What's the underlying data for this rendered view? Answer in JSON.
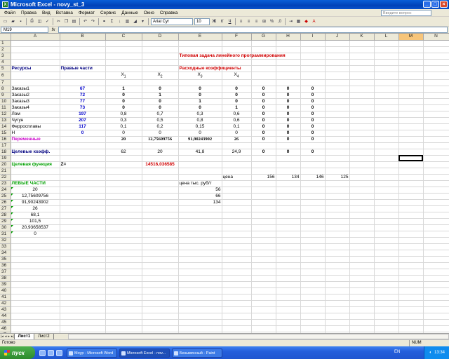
{
  "app": {
    "title": "Microsoft Excel - novy_st_3",
    "icon": "excel-app-icon"
  },
  "menu": [
    "Файл",
    "Правка",
    "Вид",
    "Вставка",
    "Формат",
    "Сервис",
    "Данные",
    "Окно",
    "Справка"
  ],
  "help_placeholder": "Введите вопрос",
  "toolbar": {
    "font": "Arial Cyr",
    "size": "10"
  },
  "namebox": "M19",
  "fx_label": "fx",
  "columns": [
    "",
    "A",
    "B",
    "C",
    "D",
    "E",
    "F",
    "G",
    "H",
    "I",
    "J",
    "K",
    "L",
    "M",
    "N"
  ],
  "rows": [
    "1",
    "2",
    "3",
    "4",
    "5",
    "6",
    "7",
    "8",
    "9",
    "10",
    "11",
    "12",
    "13",
    "14",
    "15",
    "16",
    "17",
    "18",
    "19",
    "20",
    "21",
    "22",
    "23",
    "24",
    "25",
    "26",
    "27",
    "28",
    "29",
    "30",
    "31",
    "32",
    "33",
    "34",
    "35",
    "36",
    "37",
    "38",
    "39",
    "40",
    "41",
    "42",
    "43",
    "44",
    "45",
    "46",
    "47"
  ],
  "cells": {
    "title": "Типовая задача линейного программирования",
    "resources": "Ресурсы",
    "rhs": "Правые  части",
    "rate_coef": "Расходные коэффициенты",
    "x1": "X",
    "x2": "X",
    "x3": "X",
    "x4": "X",
    "s1": "1",
    "s2": "2",
    "s3": "3",
    "s4": "4",
    "r8": [
      "Заказы1",
      "67",
      "1",
      "0",
      "0",
      "0",
      "0",
      "0",
      "0"
    ],
    "r9": [
      "Заказы2",
      "72",
      "0",
      "1",
      "0",
      "0",
      "0",
      "0",
      "0"
    ],
    "r10": [
      "Заказы3",
      "77",
      "0",
      "0",
      "1",
      "0",
      "0",
      "0",
      "0"
    ],
    "r11": [
      "Заказы4",
      "73",
      "0",
      "0",
      "0",
      "1",
      "0",
      "0",
      "0"
    ],
    "r12": [
      "Лом",
      "197",
      "0,8",
      "0,7",
      "0,3",
      "0,6",
      "0",
      "0",
      "0"
    ],
    "r13": [
      "Чугун",
      "207",
      "0,3",
      "0,5",
      "0,8",
      "0,6",
      "0",
      "0",
      "0"
    ],
    "r14": [
      "Ферросплавы",
      "117",
      "0,1",
      "0,2",
      "0,15",
      "0,1",
      "0",
      "0",
      "0"
    ],
    "r15": [
      "Н",
      "0",
      "0",
      "0",
      "0",
      "0",
      "0",
      "0",
      "0"
    ],
    "r16": [
      "Переменные",
      "20",
      "12,75609756",
      "91,90243902",
      "26",
      "0",
      "0",
      "0"
    ],
    "r18": [
      "Целевые коэфф.",
      "62",
      "20",
      "41,8",
      "24,9",
      "0",
      "0",
      "0"
    ],
    "r20": [
      "Целевая функция",
      "Z=",
      "14516,036585"
    ],
    "r22": [
      "цена",
      "156",
      "134",
      "146",
      "125"
    ],
    "left_parts": "ЛЕВЫЕ ЧАСТИ",
    "price_label": "цена тыс. руб/т",
    "lp": [
      "20",
      "12,75609756",
      "91,90243902",
      "26",
      "68,1",
      "101,5",
      "20,93658537",
      "0"
    ],
    "prices": [
      "56",
      "66",
      "134"
    ]
  },
  "tabs": [
    "Лист1",
    "Лист2"
  ],
  "status": {
    "left": "Готово",
    "num": "NUM"
  },
  "taskbar": {
    "start": "пуск",
    "tasks": [
      "Моур - Microsoft Word",
      "Microsoft Excel - nov...",
      "Безымянный - Paint"
    ],
    "lang": "EN",
    "time": "13:34"
  }
}
